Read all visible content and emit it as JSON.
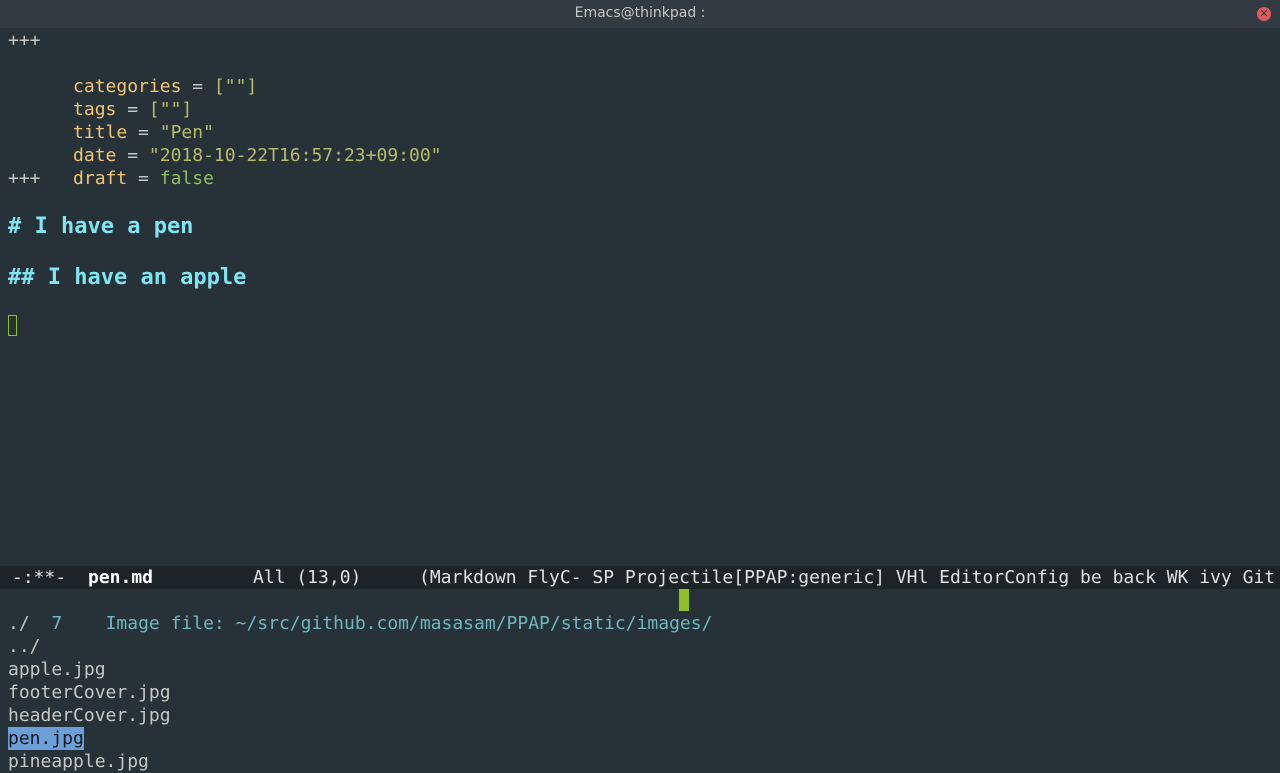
{
  "window": {
    "title": "Emacs@thinkpad :",
    "close_icon": "close-icon"
  },
  "buffer": {
    "frontmatter_open": "+++",
    "frontmatter_close": "+++",
    "fields": [
      {
        "key": "categories",
        "op": " = ",
        "value": "[\"\"]",
        "type": "string"
      },
      {
        "key": "tags",
        "op": " = ",
        "value": "[\"\"]",
        "type": "string"
      },
      {
        "key": "title",
        "op": " = ",
        "value": "\"Pen\"",
        "type": "string"
      },
      {
        "key": "date",
        "op": " = ",
        "value": "\"2018-10-22T16:57:23+09:00\"",
        "type": "string"
      },
      {
        "key": "draft",
        "op": " = ",
        "value": "false",
        "type": "bool"
      }
    ],
    "heading1": "# I have a pen",
    "heading2": "## I have an apple"
  },
  "modeline": {
    "state": "-:**-",
    "filename": "pen.md",
    "position": "All (13,0)",
    "modes": "(Markdown FlyC- SP Projectile[PPAP:generic] VHl EditorConfig be back WK ivy Git"
  },
  "minibuffer": {
    "count": "7",
    "prompt": "Image file: ",
    "input": "~/src/github.com/masasam/PPAP/static/images/",
    "candidates": [
      {
        "label": "./",
        "kind": "dir"
      },
      {
        "label": "../",
        "kind": "dir"
      },
      {
        "label": "apple.jpg",
        "kind": "file"
      },
      {
        "label": "footerCover.jpg",
        "kind": "file"
      },
      {
        "label": "headerCover.jpg",
        "kind": "file"
      },
      {
        "label": "pen.jpg",
        "kind": "file",
        "selected": true
      },
      {
        "label": "pineapple.jpg",
        "kind": "file"
      }
    ]
  },
  "colors": {
    "background": "#263238",
    "heading": "#7fe5f0",
    "key": "#f0c674",
    "string": "#b5bd68",
    "selection": "#6a9fd8",
    "cursor": "#8fbf24"
  }
}
